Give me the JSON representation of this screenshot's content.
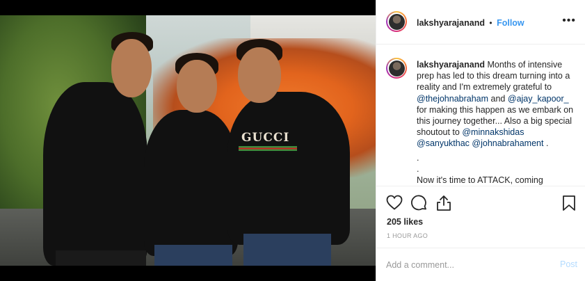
{
  "post": {
    "username": "lakshyarajanand",
    "separator": "•",
    "follow_label": "Follow",
    "more_icon": "more-options-icon",
    "image_text": "GUCCI"
  },
  "caption": {
    "username": "lakshyarajanand",
    "text_1": "Months of intensive prep has led to this dream turning into a reality and I'm extremely grateful to",
    "mention_1": "@thejohnabraham",
    "text_2": "and",
    "mention_2": "@ajay_kapoor_",
    "text_3": "for making this happen as we embark on this journey together... Also a big special shoutout to",
    "mention_3": "@minnakshidas",
    "mention_4": "@sanyukthac",
    "mention_5": "@johnabrahament",
    "text_4": ".",
    "dot_1": ".",
    "dot_2": ".",
    "text_5": "Now it's time to ATTACK, coming"
  },
  "actions": {
    "like_icon": "heart-icon",
    "comment_icon": "comment-icon",
    "share_icon": "share-icon",
    "save_icon": "bookmark-icon"
  },
  "stats": {
    "likes": "205 likes",
    "time_ago": "1 HOUR AGO"
  },
  "comment": {
    "placeholder": "Add a comment...",
    "post_label": "Post"
  },
  "colors": {
    "link": "#3897f0",
    "mention": "#003569",
    "text": "#262626",
    "muted": "#999999",
    "post_disabled": "#b3dbff"
  }
}
